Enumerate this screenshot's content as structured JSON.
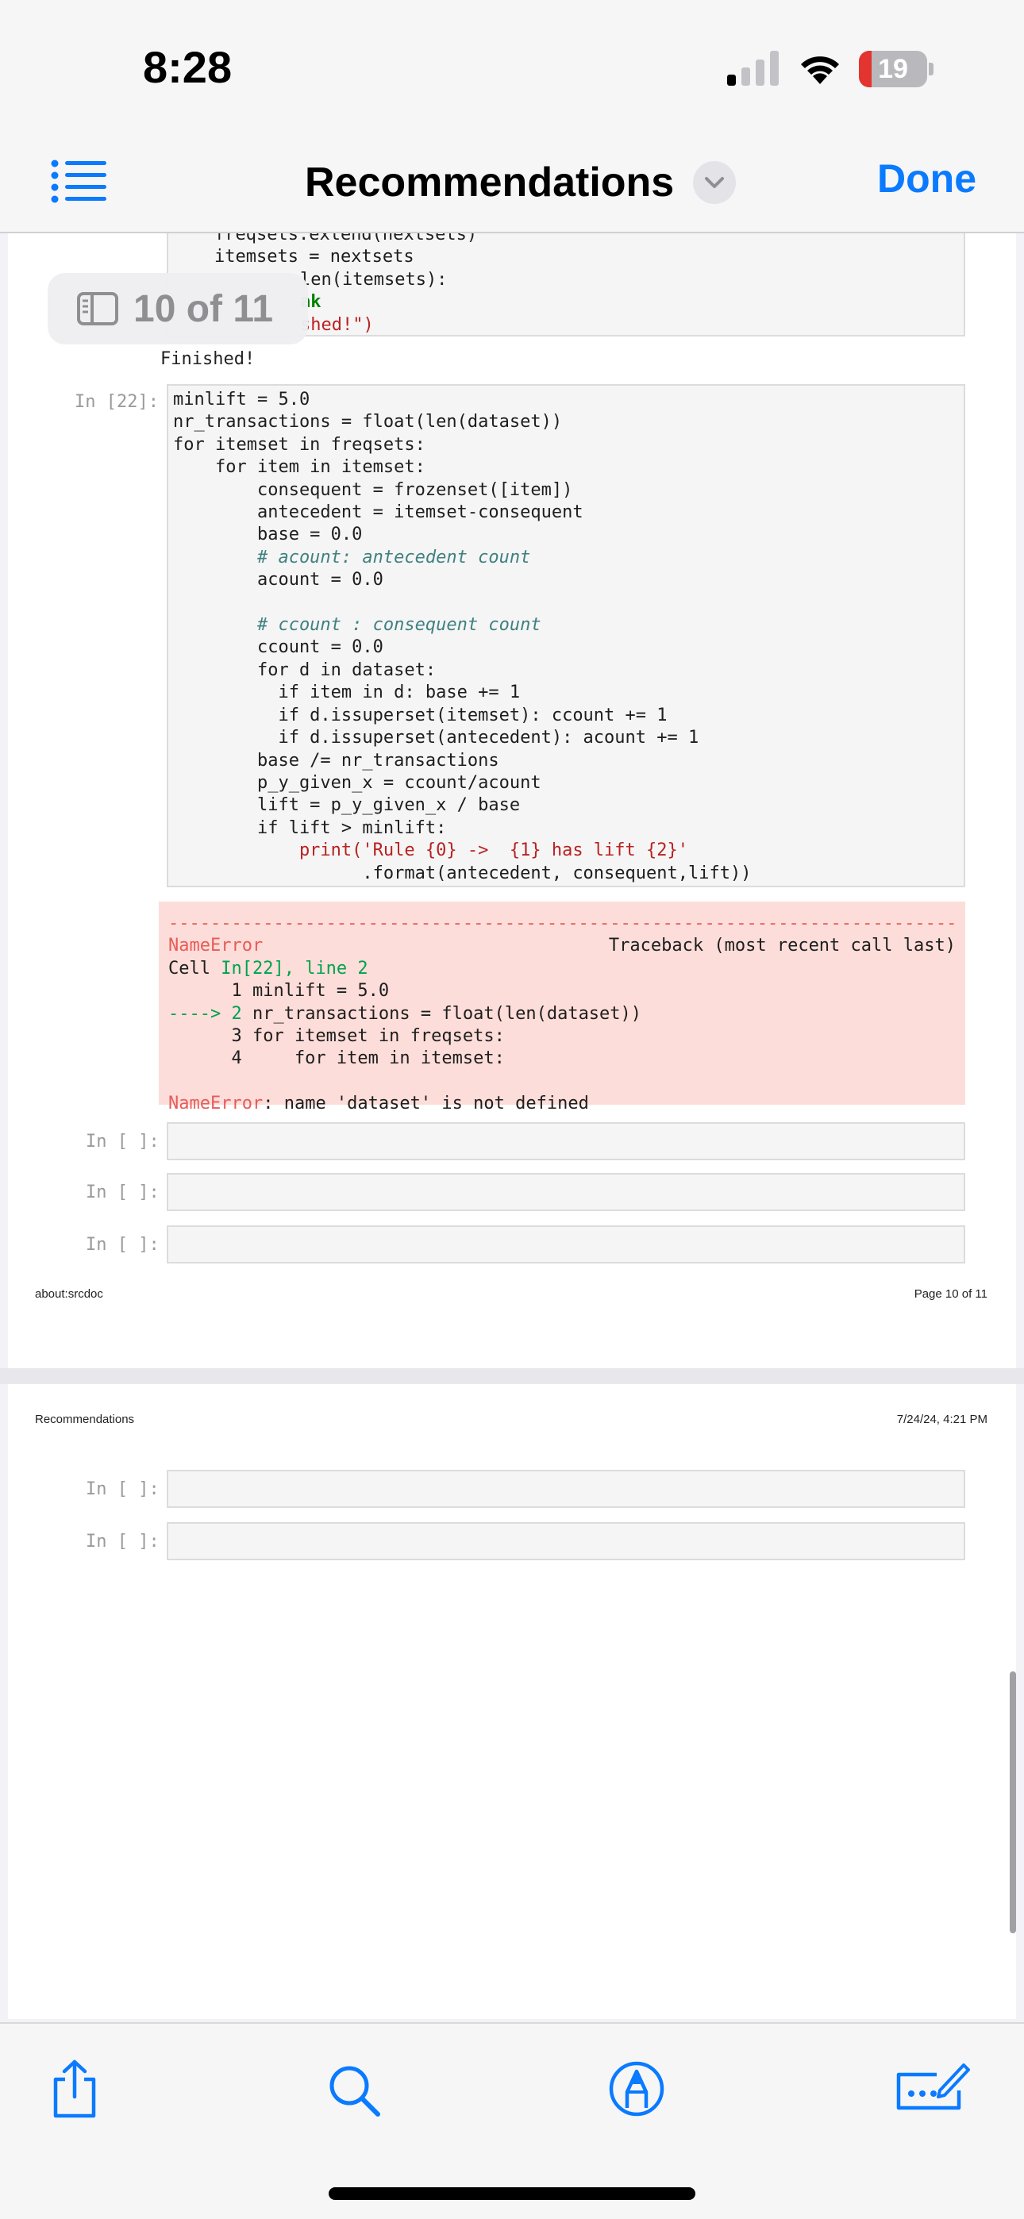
{
  "status_bar": {
    "time": "8:28",
    "battery": "19",
    "battery_level": 0.19
  },
  "nav": {
    "title": "Recommendations",
    "done_label": "Done"
  },
  "page_indicator": "10 of 11",
  "top_fragment": {
    "lines": [
      "freqsets.extend(nextsets)",
      "itemsets = nextsets",
      "len(itemsets):",
      "ak",
      "shed!\")"
    ]
  },
  "finished_output": "Finished!",
  "cell22": {
    "prompt": "In [22]:",
    "code": [
      "minlift = 5.0",
      "nr_transactions = float(len(dataset))",
      "for itemset in freqsets:",
      "    for item in itemset:",
      "        consequent = frozenset([item])",
      "        antecedent = itemset-consequent",
      "        base = 0.0",
      "        # acount: antecedent count",
      "        acount = 0.0",
      "",
      "        # ccount : consequent count",
      "        ccount = 0.0",
      "        for d in dataset:",
      "          if item in d: base += 1",
      "          if d.issuperset(itemset): ccount += 1",
      "          if d.issuperset(antecedent): acount += 1",
      "        base /= nr_transactions",
      "        p_y_given_x = ccount/acount",
      "        lift = p_y_given_x / base",
      "        if lift > minlift:",
      "            print('Rule {0} ->  {1} has lift {2}'",
      "                  .format(antecedent, consequent,lift))"
    ]
  },
  "error": {
    "dashes": "---------------------------------------------------------------------------",
    "name": "NameError",
    "traceback": "Traceback (most recent call last)",
    "cell_ref_prefix": "Cell ",
    "cell_ref": "In[22], line 2",
    "line1": "      1 minlift = 5.0",
    "arrow": "----> 2",
    "line2_code": " nr_transactions = float(len(dataset))",
    "line3": "      3 for itemset in freqsets:",
    "line4": "      4     for item in itemset:",
    "message_name": "NameError",
    "message": ": name 'dataset' is not defined"
  },
  "empty_prompt": "In [ ]:",
  "page1_footer": {
    "left": "about:srcdoc",
    "right": "Page 10 of 11"
  },
  "page2_header": {
    "left": "Recommendations",
    "right": "7/24/24, 4:21 PM"
  },
  "icons": [
    "list-icon",
    "chevron-down-icon",
    "sidebar-icon",
    "share-icon",
    "search-icon",
    "markup-icon",
    "signature-icon"
  ]
}
